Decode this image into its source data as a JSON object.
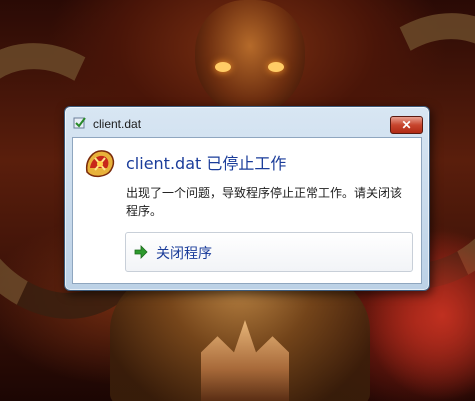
{
  "window": {
    "title": "client.dat",
    "close_glyph": "✕"
  },
  "dialog": {
    "heading": "client.dat 已停止工作",
    "message": "出现了一个问题，导致程序停止正常工作。请关闭该程序。",
    "action_label": "关闭程序"
  },
  "icons": {
    "title_icon": "program-check-icon",
    "app_icon": "game-logo-icon",
    "action_icon": "green-arrow-icon",
    "close_icon": "close-icon"
  },
  "colors": {
    "heading": "#1a3c9a",
    "close_button": "#c7452e",
    "arrow": "#2d9a2d"
  }
}
